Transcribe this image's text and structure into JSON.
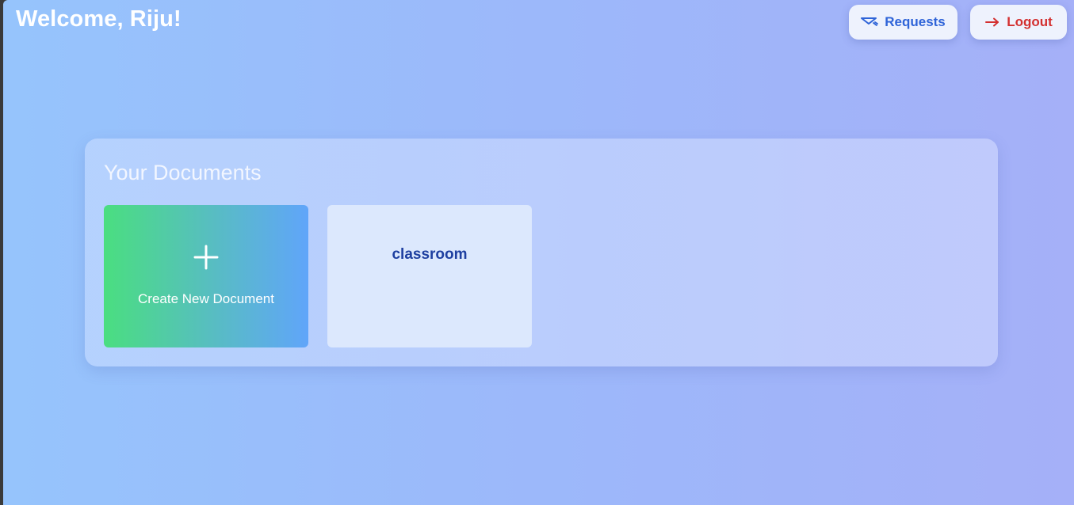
{
  "header": {
    "welcome": "Welcome, Riju!"
  },
  "actions": {
    "requests": {
      "label": "Requests",
      "icon": "mail-send-icon",
      "color": "#2f64d8"
    },
    "logout": {
      "label": "Logout",
      "icon": "arrow-right-icon",
      "color": "#d32f2f"
    }
  },
  "documents": {
    "title": "Your Documents",
    "create_label": "Create New Document",
    "items": [
      {
        "title": "classroom"
      }
    ]
  },
  "colors": {
    "background_start": "#96c4fc",
    "background_end": "#a5b0f8",
    "create_gradient_start": "#4ade80",
    "create_gradient_end": "#60a5fa",
    "doc_card": "#dce8fd",
    "doc_title": "#1e3fa0"
  }
}
